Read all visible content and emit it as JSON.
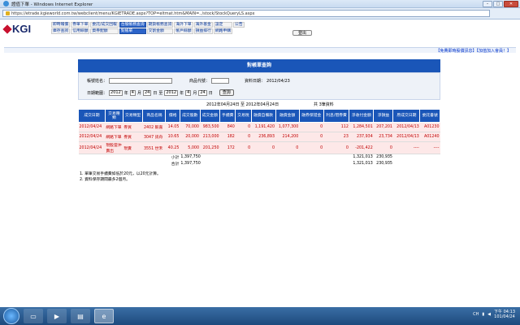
{
  "window": {
    "title": "證值下單 - Windows Internet Explorer"
  },
  "address": {
    "url": "https://etrade.kgieworld.com.tw/webclient/menu/KGIETRADE.aspx?TOP=eltmat.htm&MAIN=../stock/StockQueryLS.aspx"
  },
  "logo": {
    "text": "KGI"
  },
  "menu": {
    "row1": [
      "即時報價",
      "券單下單",
      "委託/成交回報",
      "台股帳務查詢",
      "期貨帳務查詢",
      "海外下單",
      "海外基金",
      "設定",
      "公告"
    ],
    "row2": [
      "庫存查詢",
      "信用餘額",
      "資券配額",
      "對帳單",
      "交割金額",
      "帳戶餘額",
      "損益排行",
      "網路申購"
    ],
    "active": "台股帳務查詢",
    "logout": "登出"
  },
  "toplinks": "【免費即時股價訊息】【加值加入會員！】",
  "panel": {
    "title": "對帳單查詢",
    "account_label": "帳號姓名：",
    "account_value": "",
    "stock_label": "商品代號：",
    "date_label": "資料日期：",
    "date_value": "2012/04/23",
    "range_label": "日期範圍：",
    "from": {
      "year": "2012",
      "month": "4",
      "day": "24"
    },
    "to": {
      "year": "2012",
      "month": "4",
      "day": "24"
    },
    "unit_year": "年",
    "unit_month": "月",
    "unit_day": "日",
    "to_word": "至",
    "query_button": "查詢"
  },
  "range_text": "2012年04月24日 至 2012年04月24日",
  "count_text": "共 3筆資料",
  "table": {
    "headers": [
      "成交日期",
      "交易種類",
      "交易類型",
      "商品名稱",
      "價格",
      "成交股數",
      "成交金額",
      "手續費",
      "交易稅",
      "融資自備款",
      "融資金額",
      "融券保證金",
      "利息/借券費",
      "淨收付金額",
      "淨損益",
      "原成交日期",
      "委託書號"
    ],
    "rows": [
      [
        "2012/04/24",
        "網路下單",
        "券買",
        "2402 毅嘉",
        "14.05",
        "70,000",
        "983,500",
        "840",
        "0",
        "1,191,420",
        "1,077,300",
        "0",
        "112",
        "1,284,501",
        "207,201",
        "2012/04/13",
        "A01230"
      ],
      [
        "2012/04/24",
        "網路下單",
        "券買",
        "3047 訊舟",
        "10.65",
        "20,000",
        "213,000",
        "182",
        "0",
        "236,893",
        "214,200",
        "0",
        "23",
        "237,934",
        "23,734",
        "2012/04/13",
        "A01240"
      ],
      [
        "2012/04/24",
        "現股當沖賣出",
        "現賣",
        "3551 世禾",
        "40.25",
        "5,000",
        "201,250",
        "172",
        "0",
        "0",
        "0",
        "0",
        "0",
        "-201,422",
        "0",
        "----",
        "----"
      ]
    ],
    "subtotal_label": "小計",
    "subtotal_amount": "1,397,750",
    "subtotal_net": "1,321,013",
    "subtotal_pl": "230,935",
    "total_label": "合計",
    "total_amount": "1,397,750",
    "total_net": "1,321,013",
    "total_pl": "230,935"
  },
  "notes": [
    "1. 單筆交易手續費如低於20元，以20元計算。",
    "2. 資料保存期間最多2個月。"
  ],
  "tray": {
    "lang": "CH",
    "time": "下午 04:13",
    "date": "101/04/24"
  }
}
